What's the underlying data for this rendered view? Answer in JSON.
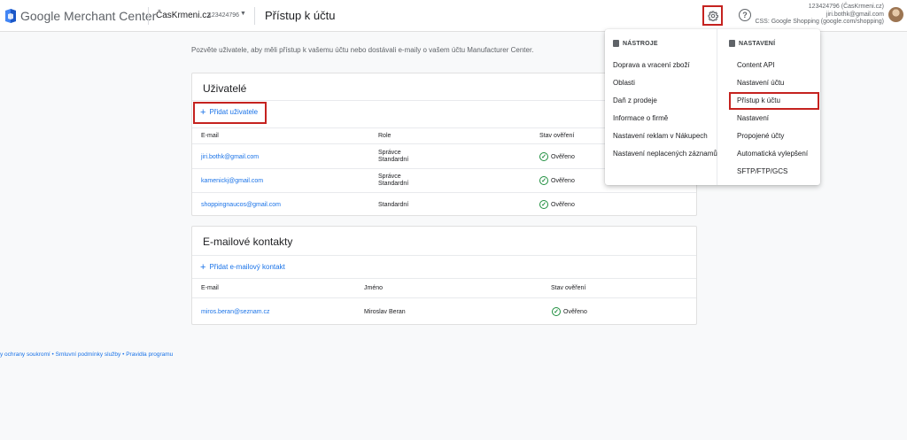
{
  "header": {
    "brand_google": "Google",
    "brand_product": "Merchant Center",
    "account_name": "ČasKrmeni.cz",
    "account_id": "123424796",
    "page_title": "Přístup k účtu",
    "help_glyph": "?",
    "user_line1": "123424796 (ČasKrmeni.cz)",
    "user_line2": "jiri.bothk@gmail.com",
    "user_line3": "CSS: Google Shopping (google.com/shopping)"
  },
  "intro_text": "Pozvěte uživatele, aby měli přístup k vašemu účtu nebo dostávali e-maily o vašem účtu Manufacturer Center.",
  "users_card": {
    "title": "Uživatelé",
    "add_label": "Přidat uživatele",
    "columns": [
      "E-mail",
      "Role",
      "Stav ověření"
    ],
    "rows": [
      {
        "email": "jiri.bothk@gmail.com",
        "role1": "Správce",
        "role2": "Standardní",
        "status": "Ověřeno"
      },
      {
        "email": "kamenickj@gmail.com",
        "role1": "Správce",
        "role2": "Standardní",
        "status": "Ověřeno"
      },
      {
        "email": "shoppingnaucos@gmail.com",
        "role1": "Standardní",
        "role2": "",
        "status": "Ověřeno"
      }
    ]
  },
  "contacts_card": {
    "title": "E-mailové kontakty",
    "add_label": "Přidat e-mailový kontakt",
    "columns": [
      "E-mail",
      "Jméno",
      "Stav ověření"
    ],
    "rows": [
      {
        "email": "miros.beran@seznam.cz",
        "name": "Miroslav Beran",
        "status": "Ověřeno"
      }
    ]
  },
  "footer": {
    "text": "y ochrany soukromí • Smluvní podmínky služby • Pravidla programu"
  },
  "dropdown": {
    "tools_header": "NÁSTROJE",
    "settings_header": "NASTAVENÍ",
    "tools": [
      "Doprava a vracení zboží",
      "Oblasti",
      "Daň z prodeje",
      "Informace o firmě",
      "Nastavení reklam v Nákupech",
      "Nastavení neplacených záznamů"
    ],
    "settings": [
      "Content API",
      "Nastavení účtu",
      "Přístup k účtu",
      "Nastavení",
      "Propojené účty",
      "Automatická vylepšení",
      "SFTP/FTP/GCS"
    ]
  },
  "colors": {
    "accent": "#1a73e8",
    "highlight": "#c5221f",
    "verified": "#1e8e3e"
  },
  "icons": [
    "merchant-logo-icon",
    "caret-down-icon",
    "gear-icon",
    "help-icon",
    "plus-icon",
    "check-circle-icon",
    "tools-icon",
    "settings-icon"
  ]
}
